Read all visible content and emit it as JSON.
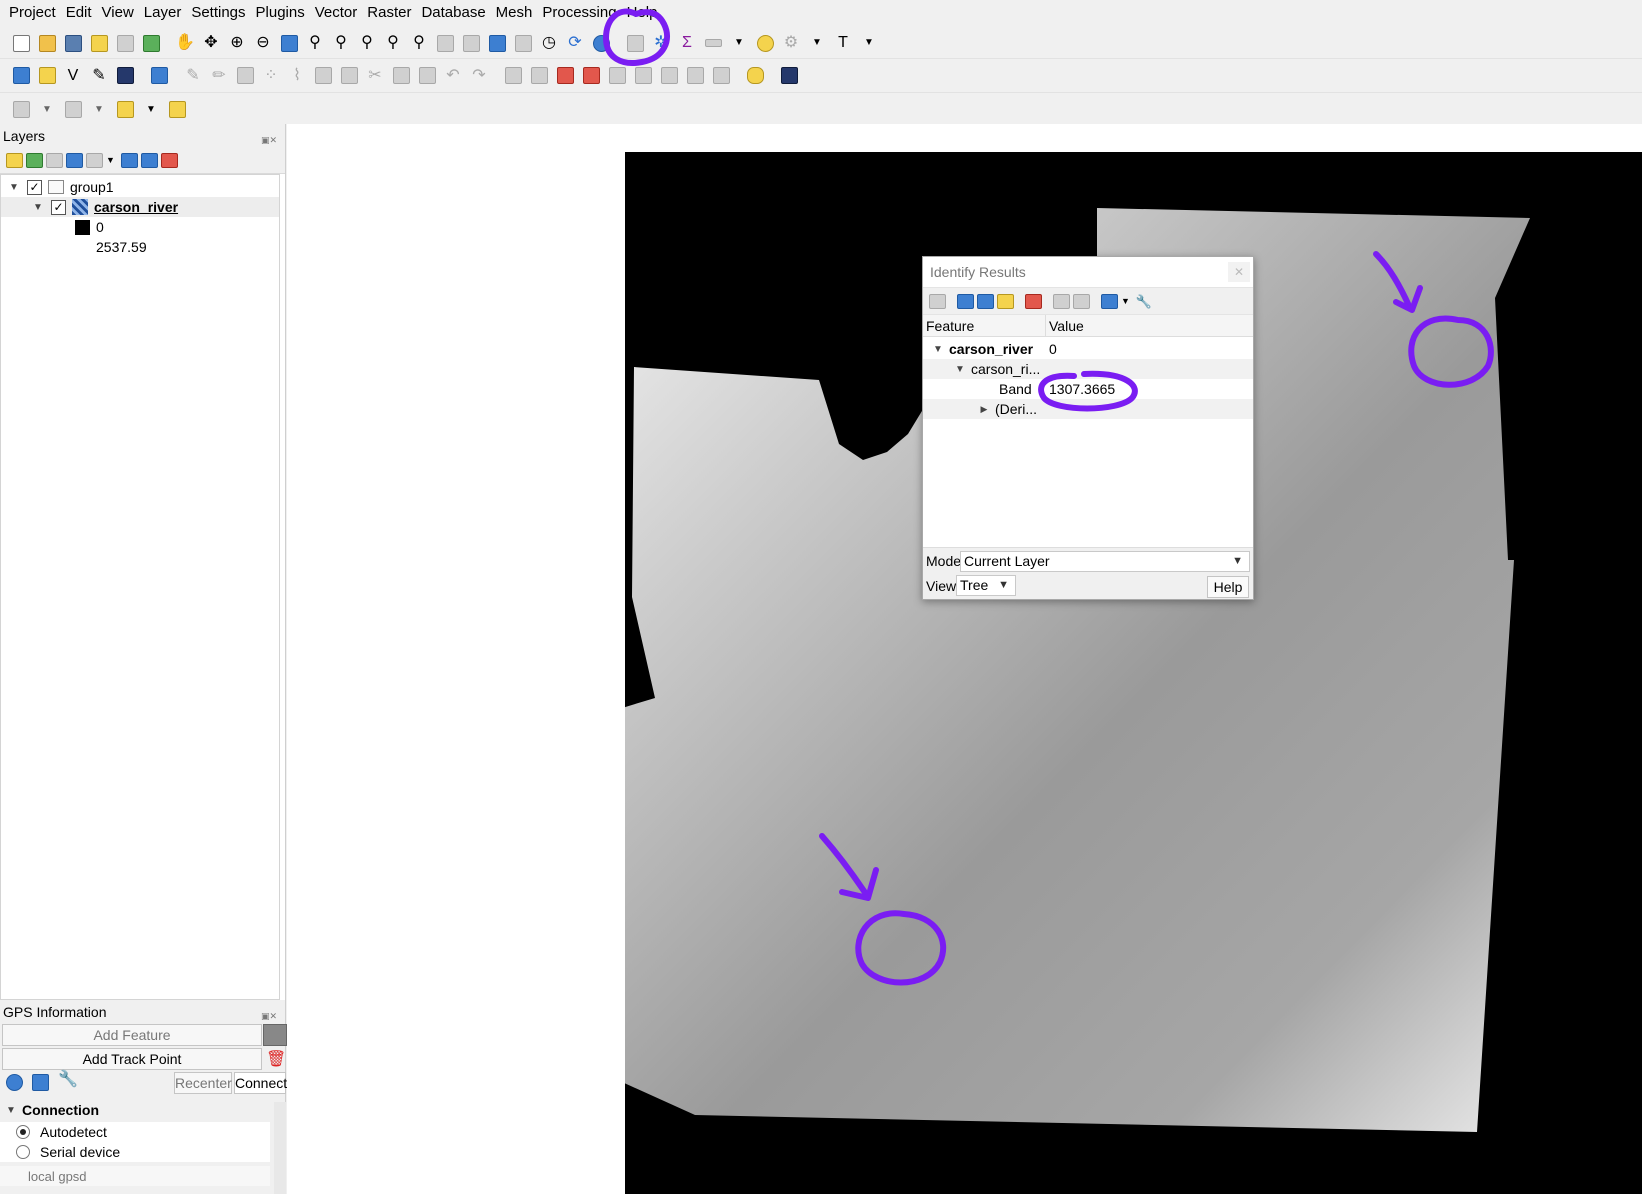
{
  "menu": [
    "Project",
    "Edit",
    "View",
    "Layer",
    "Settings",
    "Plugins",
    "Vector",
    "Raster",
    "Database",
    "Mesh",
    "Processing",
    "Help"
  ],
  "layers_panel": {
    "title": "Layers",
    "group_name": "group1",
    "layer_name": "carson_river",
    "legend_min": "0",
    "legend_max": "2537.59"
  },
  "gps_panel": {
    "title": "GPS Information",
    "add_feature": "Add Feature",
    "add_track_point": "Add Track Point",
    "recenter": "Recenter",
    "connect": "Connect",
    "connection_label": "Connection",
    "autodetect": "Autodetect",
    "serial_device": "Serial device",
    "gpsd_placeholder": "local gpsd"
  },
  "identify": {
    "title": "Identify Results",
    "col_feature": "Feature",
    "col_value": "Value",
    "layer_name": "carson_river",
    "layer_value": "0",
    "sublayer": "carson_ri...",
    "band_label": "Band",
    "band_value": "1307.3665",
    "derived": "(Deri...",
    "mode_label": "Mode",
    "mode_value": "Current Layer",
    "view_label": "View",
    "view_value": "Tree",
    "help": "Help"
  },
  "colors": {
    "annotation": "#7a1df2",
    "selection": "#ededed"
  }
}
